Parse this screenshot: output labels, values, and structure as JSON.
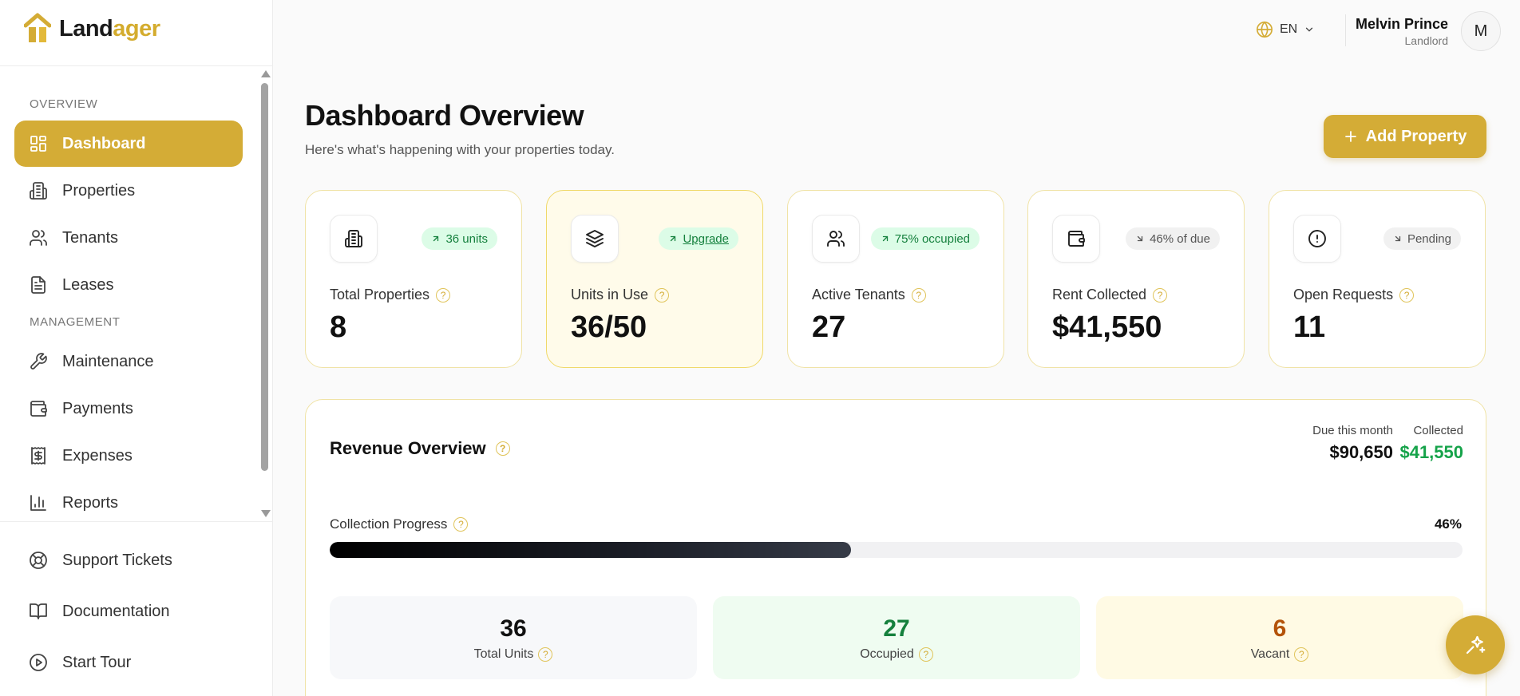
{
  "brand": {
    "name_part1": "Land",
    "name_part2": "ager",
    "accent": "#d4ac36"
  },
  "sidebar": {
    "sections": [
      "OVERVIEW",
      "MANAGEMENT"
    ],
    "items": [
      {
        "label": "Dashboard",
        "icon": "dashboard-icon",
        "active": true
      },
      {
        "label": "Properties",
        "icon": "building-icon"
      },
      {
        "label": "Tenants",
        "icon": "users-icon"
      },
      {
        "label": "Leases",
        "icon": "document-icon"
      },
      {
        "label": "Maintenance",
        "icon": "wrench-icon"
      },
      {
        "label": "Payments",
        "icon": "wallet-icon"
      },
      {
        "label": "Expenses",
        "icon": "receipt-icon"
      },
      {
        "label": "Reports",
        "icon": "bar-chart-icon"
      }
    ],
    "bottom_items": [
      {
        "label": "Support Tickets",
        "icon": "lifebuoy-icon"
      },
      {
        "label": "Documentation",
        "icon": "book-icon"
      },
      {
        "label": "Start Tour",
        "icon": "play-circle-icon"
      }
    ]
  },
  "header": {
    "language": "EN",
    "user_name": "Melvin Prince",
    "user_role": "Landlord",
    "avatar_initial": "M"
  },
  "page": {
    "title": "Dashboard Overview",
    "subtitle": "Here's what's happening with your properties today.",
    "add_button": "Add Property"
  },
  "cards": [
    {
      "label": "Total Properties",
      "value": "8",
      "badge": "36 units",
      "badge_style": "green",
      "icon": "building-icon"
    },
    {
      "label": "Units in Use",
      "value": "36/50",
      "badge": "Upgrade",
      "badge_style": "green",
      "icon": "layers-icon"
    },
    {
      "label": "Active Tenants",
      "value": "27",
      "badge": "75% occupied",
      "badge_style": "green",
      "icon": "users-icon"
    },
    {
      "label": "Rent Collected",
      "value": "$41,550",
      "badge": "46% of due",
      "badge_style": "gray",
      "icon": "wallet-icon"
    },
    {
      "label": "Open Requests",
      "value": "11",
      "badge": "Pending",
      "badge_style": "gray",
      "icon": "alert-circle-icon"
    }
  ],
  "revenue": {
    "title": "Revenue Overview",
    "due_label": "Due this month",
    "due_value": "$90,650",
    "collected_label": "Collected",
    "collected_value": "$41,550",
    "progress_label": "Collection Progress",
    "progress_text": "46%",
    "progress_fraction": 0.46,
    "stats": [
      {
        "value": "36",
        "label": "Total Units"
      },
      {
        "value": "27",
        "label": "Occupied"
      },
      {
        "value": "6",
        "label": "Vacant"
      }
    ]
  },
  "fab": {
    "icon": "sparkles-icon"
  }
}
